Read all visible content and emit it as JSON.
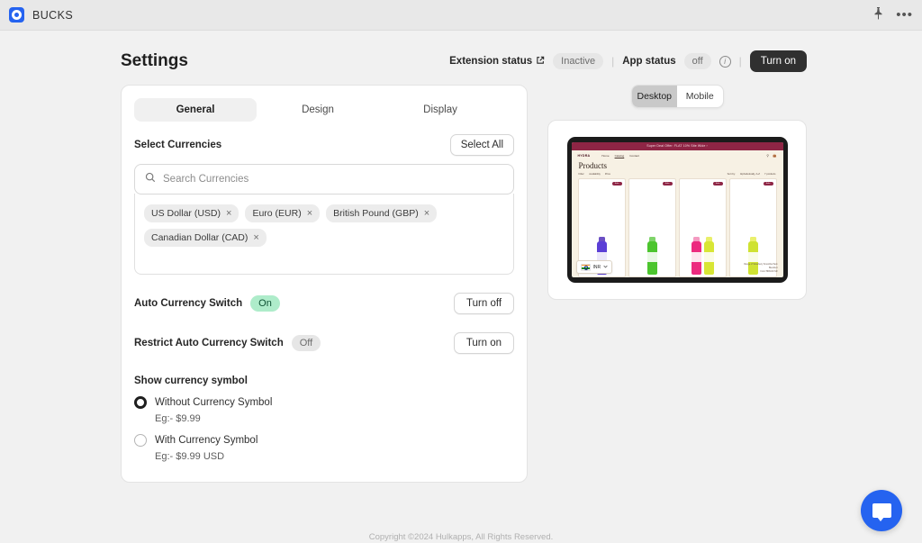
{
  "appbar": {
    "app_name": "BUCKS",
    "pin_icon": "pin-icon",
    "more_icon": "•••"
  },
  "header": {
    "title": "Settings",
    "extension_status_label": "Extension status",
    "extension_status_value": "Inactive",
    "app_status_label": "App status",
    "app_status_value": "off",
    "info_icon": "i",
    "turn_on_button": "Turn on",
    "separator": "|"
  },
  "tabs": [
    {
      "label": "General",
      "active": true
    },
    {
      "label": "Design",
      "active": false
    },
    {
      "label": "Display",
      "active": false
    }
  ],
  "currencies": {
    "section_label": "Select Currencies",
    "select_all_button": "Select All",
    "search_placeholder": "Search Currencies",
    "search_value": "",
    "search_icon": "search-icon",
    "chips": [
      {
        "label": "US Dollar (USD)",
        "remove": "×"
      },
      {
        "label": "Euro (EUR)",
        "remove": "×"
      },
      {
        "label": "British Pound (GBP)",
        "remove": "×"
      },
      {
        "label": "Canadian Dollar (CAD)",
        "remove": "×"
      }
    ]
  },
  "toggles": [
    {
      "label": "Auto Currency Switch",
      "state": "On",
      "button": "Turn off"
    },
    {
      "label": "Restrict Auto Currency Switch",
      "state": "Off",
      "button": "Turn on"
    }
  ],
  "symbol_section": {
    "heading": "Show currency symbol",
    "options": [
      {
        "label": "Without Currency Symbol",
        "example": "Eg:- $9.99",
        "selected": true
      },
      {
        "label": "With Currency Symbol",
        "example": "Eg:- $9.99 USD",
        "selected": false
      }
    ]
  },
  "preview": {
    "segments": [
      {
        "label": "Desktop",
        "active": true
      },
      {
        "label": "Mobile",
        "active": false
      }
    ],
    "store": {
      "banner_text": "Super Deal Offer: FLAT 10% Site Wide ›",
      "logo": "HYDRA",
      "nav": [
        "Home",
        "Catalog",
        "Contact"
      ],
      "search_icon": "search-icon",
      "cart_icon": "cart-icon",
      "page_title": "Products",
      "filter_label": "Filter:",
      "filters": [
        "Availability",
        "Price"
      ],
      "sort_label": "Sort by:",
      "sort_value": "Alphabetically, A-Z",
      "product_count": "7 products",
      "sale_badge": "Sale",
      "currency_code": "INR",
      "currency_chevron": "⌄",
      "flag_icon": "india-flag-icon",
      "meta_lines": [
        "Range of Strawberry Smoothie Pack",
        "Blendfect",
        "From ₹999.00 INR"
      ]
    }
  },
  "chat": {
    "icon": "chat-bubble-icon"
  },
  "footer": {
    "text": "Copyright ©2024 Hulkapps, All Rights Reserved."
  },
  "colors": {
    "accent": "#2563f0",
    "dark_button": "#303030",
    "badge_green_bg": "#aeecca",
    "badge_gray_bg": "#e6e6e6",
    "store_banner": "#8e2545"
  }
}
